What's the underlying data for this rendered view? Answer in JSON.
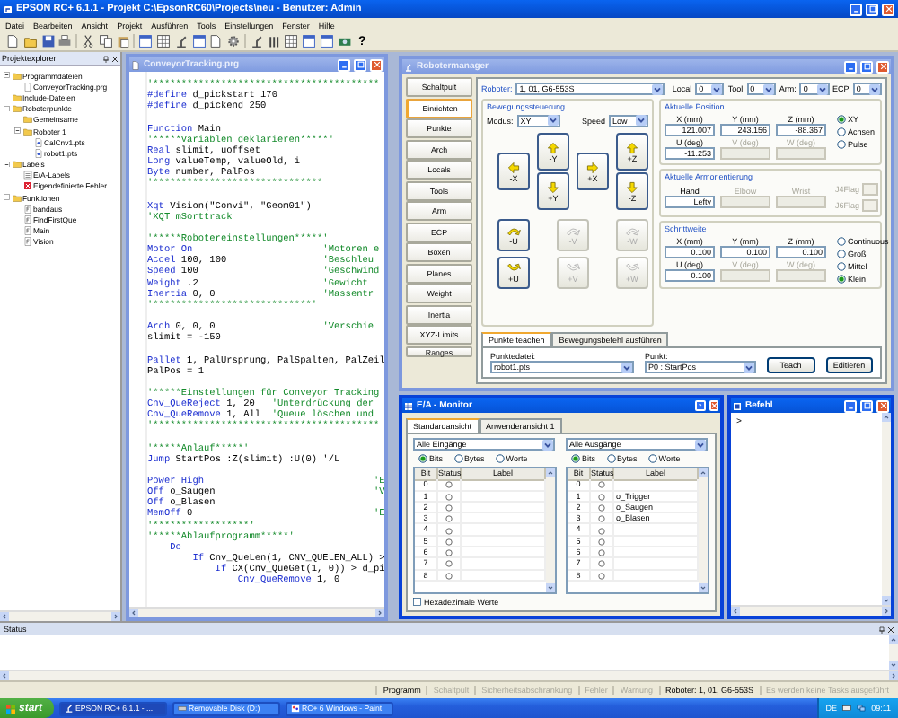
{
  "window": {
    "title": "EPSON RC+ 6.1.1 - Projekt C:\\EpsonRC60\\Projects\\neu - Benutzer: Admin"
  },
  "menu": [
    "Datei",
    "Bearbeiten",
    "Ansicht",
    "Projekt",
    "Ausführen",
    "Tools",
    "Einstellungen",
    "Fenster",
    "Hilfe"
  ],
  "toolbar": {
    "help": "?"
  },
  "explorer": {
    "title": "Projektexplorer",
    "tree": [
      {
        "label": "Programmdateien",
        "kind": "folder",
        "expanded": true,
        "children": [
          {
            "label": "ConveyorTracking.prg",
            "kind": "file"
          }
        ]
      },
      {
        "label": "Include-Dateien",
        "kind": "folder"
      },
      {
        "label": "Roboterpunkte",
        "kind": "folder",
        "expanded": true,
        "children": [
          {
            "label": "Gemeinsame",
            "kind": "folder"
          },
          {
            "label": "Roboter 1",
            "kind": "folder",
            "expanded": true,
            "children": [
              {
                "label": "CalCnv1.pts",
                "kind": "points"
              },
              {
                "label": "robot1.pts",
                "kind": "points"
              }
            ]
          }
        ]
      },
      {
        "label": "Labels",
        "kind": "folder",
        "expanded": true,
        "children": [
          {
            "label": "E/A-Labels",
            "kind": "list"
          },
          {
            "label": "Eigendefinierte Fehler",
            "kind": "error"
          }
        ]
      },
      {
        "label": "Funktionen",
        "kind": "folder",
        "expanded": true,
        "children": [
          {
            "label": "bandaus",
            "kind": "function"
          },
          {
            "label": "FindFirstQue",
            "kind": "function"
          },
          {
            "label": "Main",
            "kind": "function"
          },
          {
            "label": "Vision",
            "kind": "function"
          }
        ]
      }
    ]
  },
  "editor": {
    "title": "ConveyorTracking.prg",
    "active": false,
    "lines": [
      {
        "kind": "code",
        "segments": [
          {
            "kind": "comment",
            "text": "'****************************************"
          }
        ]
      },
      {
        "kind": "code",
        "segments": [
          {
            "kind": "keyword",
            "text": "#define"
          },
          {
            "kind": "plain",
            "text": " d_pickstart 170"
          }
        ]
      },
      {
        "kind": "code",
        "segments": [
          {
            "kind": "keyword",
            "text": "#define"
          },
          {
            "kind": "plain",
            "text": " d_pickend 250"
          }
        ]
      },
      {
        "kind": "blank"
      },
      {
        "kind": "code",
        "segments": [
          {
            "kind": "keyword",
            "text": "Function"
          },
          {
            "kind": "plain",
            "text": " Main"
          }
        ]
      },
      {
        "kind": "code",
        "segments": [
          {
            "kind": "comment",
            "text": "'*****Variablen deklarieren*****'"
          }
        ]
      },
      {
        "kind": "code",
        "segments": [
          {
            "kind": "keyword",
            "text": "Real"
          },
          {
            "kind": "plain",
            "text": " slimit, uoffset"
          }
        ]
      },
      {
        "kind": "code",
        "segments": [
          {
            "kind": "keyword",
            "text": "Long"
          },
          {
            "kind": "plain",
            "text": " valueTemp, valueOld, i"
          }
        ]
      },
      {
        "kind": "code",
        "segments": [
          {
            "kind": "keyword",
            "text": "Byte"
          },
          {
            "kind": "plain",
            "text": " number, PalPos"
          }
        ]
      },
      {
        "kind": "code",
        "segments": [
          {
            "kind": "comment",
            "text": "'******************************"
          }
        ]
      },
      {
        "kind": "blank"
      },
      {
        "kind": "code",
        "segments": [
          {
            "kind": "keyword",
            "text": "Xqt"
          },
          {
            "kind": "plain",
            "text": " Vision(\"Convi\", \"Geom01\")"
          }
        ]
      },
      {
        "kind": "code",
        "segments": [
          {
            "kind": "comment",
            "text": "'XQT mSorttrack"
          }
        ]
      },
      {
        "kind": "blank"
      },
      {
        "kind": "code",
        "segments": [
          {
            "kind": "comment",
            "text": "'*****Robotereinstellungen*****'"
          }
        ]
      },
      {
        "kind": "code",
        "segments": [
          {
            "kind": "keyword",
            "text": "Motor On"
          },
          {
            "kind": "comment",
            "text": "                       'Motoren e"
          }
        ]
      },
      {
        "kind": "code",
        "segments": [
          {
            "kind": "keyword",
            "text": "Accel"
          },
          {
            "kind": "plain",
            "text": " 100, 100                 "
          },
          {
            "kind": "comment",
            "text": "'Beschleu"
          }
        ]
      },
      {
        "kind": "code",
        "segments": [
          {
            "kind": "keyword",
            "text": "Speed"
          },
          {
            "kind": "plain",
            "text": " 100                      "
          },
          {
            "kind": "comment",
            "text": "'Geschwind"
          }
        ]
      },
      {
        "kind": "code",
        "segments": [
          {
            "kind": "keyword",
            "text": "Weight"
          },
          {
            "kind": "plain",
            "text": " .2                      "
          },
          {
            "kind": "comment",
            "text": "'Gewicht"
          }
        ]
      },
      {
        "kind": "code",
        "segments": [
          {
            "kind": "keyword",
            "text": "Inertia"
          },
          {
            "kind": "plain",
            "text": " 0, 0                   "
          },
          {
            "kind": "comment",
            "text": "'Massentr"
          }
        ]
      },
      {
        "kind": "code",
        "segments": [
          {
            "kind": "comment",
            "text": "'****************************'"
          }
        ]
      },
      {
        "kind": "blank"
      },
      {
        "kind": "code",
        "segments": [
          {
            "kind": "keyword",
            "text": "Arch"
          },
          {
            "kind": "plain",
            "text": " 0, 0, 0                   "
          },
          {
            "kind": "comment",
            "text": "'Verschie"
          }
        ]
      },
      {
        "kind": "code",
        "segments": [
          {
            "kind": "plain",
            "text": "slimit = -150"
          }
        ]
      },
      {
        "kind": "blank"
      },
      {
        "kind": "code",
        "segments": [
          {
            "kind": "keyword",
            "text": "Pallet"
          },
          {
            "kind": "plain",
            "text": " 1, PalUrsprung, PalSpalten, PalZeil"
          }
        ]
      },
      {
        "kind": "code",
        "segments": [
          {
            "kind": "plain",
            "text": "PalPos = 1"
          }
        ]
      },
      {
        "kind": "blank"
      },
      {
        "kind": "code",
        "segments": [
          {
            "kind": "comment",
            "text": "'*****Einstellungen für Conveyor Tracking"
          }
        ]
      },
      {
        "kind": "code",
        "segments": [
          {
            "kind": "keyword",
            "text": "Cnv_QueReject"
          },
          {
            "kind": "plain",
            "text": " 1, 20   "
          },
          {
            "kind": "comment",
            "text": "'Unterdrückung der"
          }
        ]
      },
      {
        "kind": "code",
        "segments": [
          {
            "kind": "keyword",
            "text": "Cnv_QueRemove"
          },
          {
            "kind": "plain",
            "text": " 1, All  "
          },
          {
            "kind": "comment",
            "text": "'Queue löschen und"
          }
        ]
      },
      {
        "kind": "code",
        "segments": [
          {
            "kind": "comment",
            "text": "'****************************************"
          }
        ]
      },
      {
        "kind": "blank"
      },
      {
        "kind": "code",
        "segments": [
          {
            "kind": "comment",
            "text": "'*****Anlauf*****'"
          }
        ]
      },
      {
        "kind": "code",
        "segments": [
          {
            "kind": "keyword",
            "text": "Jump"
          },
          {
            "kind": "plain",
            "text": " StartPos :Z(slimit) :U(0) '/L"
          }
        ]
      },
      {
        "kind": "blank"
      },
      {
        "kind": "code",
        "segments": [
          {
            "kind": "keyword",
            "text": "Power High"
          },
          {
            "kind": "comment",
            "text": "                              'E"
          }
        ]
      },
      {
        "kind": "code",
        "segments": [
          {
            "kind": "keyword",
            "text": "Off"
          },
          {
            "kind": "plain",
            "text": " o_Saugen                            "
          },
          {
            "kind": "comment",
            "text": "'V"
          }
        ]
      },
      {
        "kind": "code",
        "segments": [
          {
            "kind": "keyword",
            "text": "Off"
          },
          {
            "kind": "plain",
            "text": " o_Blasen"
          }
        ]
      },
      {
        "kind": "code",
        "segments": [
          {
            "kind": "keyword",
            "text": "MemOff"
          },
          {
            "kind": "plain",
            "text": " 0                                "
          },
          {
            "kind": "comment",
            "text": "'E"
          }
        ]
      },
      {
        "kind": "code",
        "segments": [
          {
            "kind": "comment",
            "text": "'*****************'"
          }
        ]
      },
      {
        "kind": "code",
        "segments": [
          {
            "kind": "comment",
            "text": "'*****Ablaufprogramm*****'"
          }
        ]
      },
      {
        "kind": "code",
        "segments": [
          {
            "kind": "keyword",
            "text": "    Do"
          }
        ]
      },
      {
        "kind": "code",
        "segments": [
          {
            "kind": "keyword",
            "text": "        If"
          },
          {
            "kind": "plain",
            "text": " Cnv_QueLen(1, CNV_QUELEN_ALL) >"
          }
        ]
      },
      {
        "kind": "code",
        "segments": [
          {
            "kind": "keyword",
            "text": "            If"
          },
          {
            "kind": "plain",
            "text": " CX(Cnv_QueGet(1, 0)) > d_pi"
          }
        ]
      },
      {
        "kind": "code",
        "segments": [
          {
            "kind": "keyword",
            "text": "                Cnv_QueRemove"
          },
          {
            "kind": "plain",
            "text": " 1, 0"
          }
        ]
      }
    ]
  },
  "robot_manager": {
    "title": "Robotermanager",
    "active": false,
    "tabs": [
      {
        "label": "Schaltpult",
        "selected": false
      },
      {
        "label": "Einrichten",
        "selected": true
      },
      {
        "label": "Punkte",
        "selected": false
      },
      {
        "label": "Arch",
        "selected": false
      },
      {
        "label": "Locals",
        "selected": false
      },
      {
        "label": "Tools",
        "selected": false
      },
      {
        "label": "Arm",
        "selected": false
      },
      {
        "label": "ECP",
        "selected": false
      },
      {
        "label": "Boxen",
        "selected": false
      },
      {
        "label": "Planes",
        "selected": false
      },
      {
        "label": "Weight",
        "selected": false
      },
      {
        "label": "Inertia",
        "selected": false
      },
      {
        "label": "XYZ-Limits",
        "selected": false
      },
      {
        "label": "Ranges",
        "selected": false
      }
    ],
    "robot": {
      "label": "Roboter:",
      "value": "1, 01, G6-553S"
    },
    "selectors": [
      {
        "label": "Local",
        "value": "0"
      },
      {
        "label": "Tool",
        "value": "0"
      },
      {
        "label": "Arm:",
        "value": "0"
      },
      {
        "label": "ECP",
        "value": "0"
      }
    ],
    "motion": {
      "title": "Bewegungssteuerung",
      "mode": {
        "label": "Modus:",
        "value": "XY"
      },
      "speed": {
        "label": "Speed",
        "value": "Low"
      },
      "jog": [
        {
          "label": "-Y",
          "kind": "up",
          "enabled": true
        },
        {
          "label": "-X",
          "kind": "left",
          "enabled": true
        },
        {
          "label": "+X",
          "kind": "right",
          "enabled": true
        },
        {
          "label": "+Y",
          "kind": "down",
          "enabled": true
        },
        {
          "label": "+Z",
          "kind": "up",
          "enabled": true
        },
        {
          "label": "-Z",
          "kind": "down",
          "enabled": true
        }
      ],
      "rotate": [
        {
          "label": "-U",
          "kind": "ccw",
          "enabled": true
        },
        {
          "label": "-V",
          "kind": "ccw",
          "enabled": false
        },
        {
          "label": "-W",
          "kind": "ccw",
          "enabled": false
        },
        {
          "label": "+U",
          "kind": "cw",
          "enabled": true
        },
        {
          "label": "+V",
          "kind": "cw",
          "enabled": false
        },
        {
          "label": "+W",
          "kind": "cw",
          "enabled": false
        }
      ]
    },
    "position": {
      "title": "Aktuelle Position",
      "fields": [
        {
          "label": "X (mm)",
          "value": "121.007",
          "disabled": false
        },
        {
          "label": "Y (mm)",
          "value": "243.156",
          "disabled": false
        },
        {
          "label": "Z (mm)",
          "value": "-88.367",
          "disabled": false
        },
        {
          "label": "U (deg)",
          "value": "-11.253",
          "disabled": false
        },
        {
          "label": "V (deg)",
          "disabled": true
        },
        {
          "label": "W (deg)",
          "disabled": true
        }
      ],
      "modes": [
        {
          "label": "XY",
          "selected": true
        },
        {
          "label": "Achsen",
          "selected": false
        },
        {
          "label": "Pulse",
          "selected": false
        }
      ]
    },
    "orientation": {
      "title": "Aktuelle Armorientierung",
      "fields": [
        {
          "label": "Hand",
          "value": "Lefty",
          "disabled": false
        },
        {
          "label": "Elbow",
          "disabled": true
        },
        {
          "label": "Wrist",
          "disabled": true
        }
      ],
      "flags": [
        {
          "label": "J4Flag",
          "disabled": true
        },
        {
          "label": "J6Flag",
          "disabled": true
        }
      ]
    },
    "step": {
      "title": "Schrittweite",
      "fields": [
        {
          "label": "X (mm)",
          "value": "0.100",
          "disabled": false
        },
        {
          "label": "Y (mm)",
          "value": "0.100",
          "disabled": false
        },
        {
          "label": "Z (mm)",
          "value": "0.100",
          "disabled": false
        },
        {
          "label": "U (deg)",
          "value": "0.100",
          "disabled": false
        },
        {
          "label": "V (deg)",
          "disabled": true
        },
        {
          "label": "W (deg)",
          "disabled": true
        }
      ],
      "modes": [
        {
          "label": "Continuous",
          "selected": false
        },
        {
          "label": "Groß",
          "selected": false
        },
        {
          "label": "Mittel",
          "selected": false
        },
        {
          "label": "Klein",
          "selected": true
        }
      ]
    },
    "bottom_tabs": [
      {
        "label": "Punkte teachen",
        "selected": true
      },
      {
        "label": "Bewegungsbefehl ausführen",
        "selected": false
      }
    ],
    "point_file": {
      "label": "Punktedatei:",
      "value": "robot1.pts"
    },
    "point": {
      "label": "Punkt:",
      "value": "P0 : StartPos"
    },
    "buttons": [
      "Teach",
      "Editieren"
    ]
  },
  "io_monitor": {
    "title": "E/A - Monitor",
    "active": true,
    "tabs": [
      {
        "label": "Standardansicht",
        "selected": true
      },
      {
        "label": "Anwenderansicht 1",
        "selected": false
      }
    ],
    "panels": [
      {
        "source": "Alle Eingänge",
        "formats": [
          {
            "label": "Bits",
            "selected": true
          },
          {
            "label": "Bytes",
            "selected": false
          },
          {
            "label": "Worte",
            "selected": false
          }
        ],
        "columns": [
          "Bit",
          "Status",
          "Label"
        ],
        "rows": [
          {
            "bit": "0",
            "on": false
          },
          {
            "bit": "1",
            "on": false
          },
          {
            "bit": "2",
            "on": false
          },
          {
            "bit": "3",
            "on": false
          },
          {
            "bit": "4",
            "on": false
          },
          {
            "bit": "5",
            "on": false
          },
          {
            "bit": "6",
            "on": false
          },
          {
            "bit": "7",
            "on": false
          },
          {
            "bit": "8",
            "on": false
          }
        ]
      },
      {
        "source": "Alle Ausgänge",
        "formats": [
          {
            "label": "Bits",
            "selected": true
          },
          {
            "label": "Bytes",
            "selected": false
          },
          {
            "label": "Worte",
            "selected": false
          }
        ],
        "columns": [
          "Bit",
          "Status",
          "Label"
        ],
        "rows": [
          {
            "bit": "0",
            "on": false
          },
          {
            "bit": "1",
            "on": false,
            "label": "o_Trigger"
          },
          {
            "bit": "2",
            "on": false,
            "label": "o_Saugen"
          },
          {
            "bit": "3",
            "on": false,
            "label": "o_Blasen"
          },
          {
            "bit": "4",
            "on": false
          },
          {
            "bit": "5",
            "on": false
          },
          {
            "bit": "6",
            "on": false
          },
          {
            "bit": "7",
            "on": false
          },
          {
            "bit": "8",
            "on": false
          }
        ]
      }
    ],
    "hex": {
      "label": "Hexadezimale Werte",
      "checked": false
    }
  },
  "command": {
    "title": "Befehl",
    "active": true,
    "prompt": ">"
  },
  "status_panel": {
    "title": "Status"
  },
  "status_bar": [
    {
      "text": "Programm",
      "disabled": false
    },
    {
      "text": "Schaltpult",
      "disabled": true
    },
    {
      "text": "Sicherheitsabschrankung",
      "disabled": true
    },
    {
      "text": "Fehler",
      "disabled": true
    },
    {
      "text": "Warnung",
      "disabled": true
    },
    {
      "text": "Roboter: 1, 01, G6-553S",
      "disabled": false
    },
    {
      "text": "Es werden keine Tasks ausgeführt",
      "disabled": true
    }
  ],
  "taskbar": {
    "start": "start",
    "tasks": [
      {
        "label": "EPSON RC+ 6.1.1 - ...",
        "kind": "app",
        "selected": true
      },
      {
        "label": "Removable Disk (D:)",
        "kind": "drive",
        "selected": false
      },
      {
        "label": "RC+ 6 Windows - Paint",
        "kind": "paint",
        "selected": false
      }
    ],
    "language": "DE",
    "time": "09:11"
  }
}
